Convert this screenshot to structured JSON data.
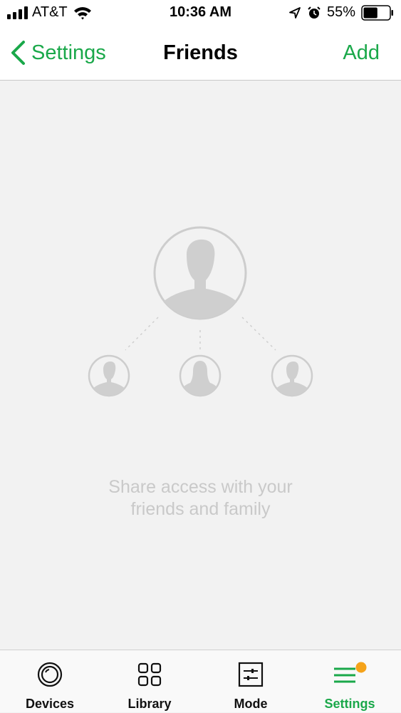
{
  "status_bar": {
    "carrier": "AT&T",
    "time": "10:36 AM",
    "battery_percent": "55%",
    "battery_level": 0.55,
    "icons": [
      "signal-bars-icon",
      "wifi-icon",
      "location-arrow-icon",
      "alarm-clock-icon",
      "battery-icon"
    ]
  },
  "nav": {
    "back_label": "Settings",
    "title": "Friends",
    "add_label": "Add"
  },
  "empty_state": {
    "line1": "Share access with your",
    "line2": "friends and family",
    "icon": "friends-share-illustration"
  },
  "tabs": [
    {
      "label": "Devices",
      "icon": "camera-lens-icon",
      "active": false
    },
    {
      "label": "Library",
      "icon": "grid-icon",
      "active": false
    },
    {
      "label": "Mode",
      "icon": "sliders-icon",
      "active": false
    },
    {
      "label": "Settings",
      "icon": "menu-lines-icon",
      "active": true,
      "badge": true
    }
  ],
  "colors": {
    "accent": "#1aa84a",
    "badge": "#f5a31a",
    "background": "#f2f2f2",
    "muted_text": "#c9c9c9"
  }
}
